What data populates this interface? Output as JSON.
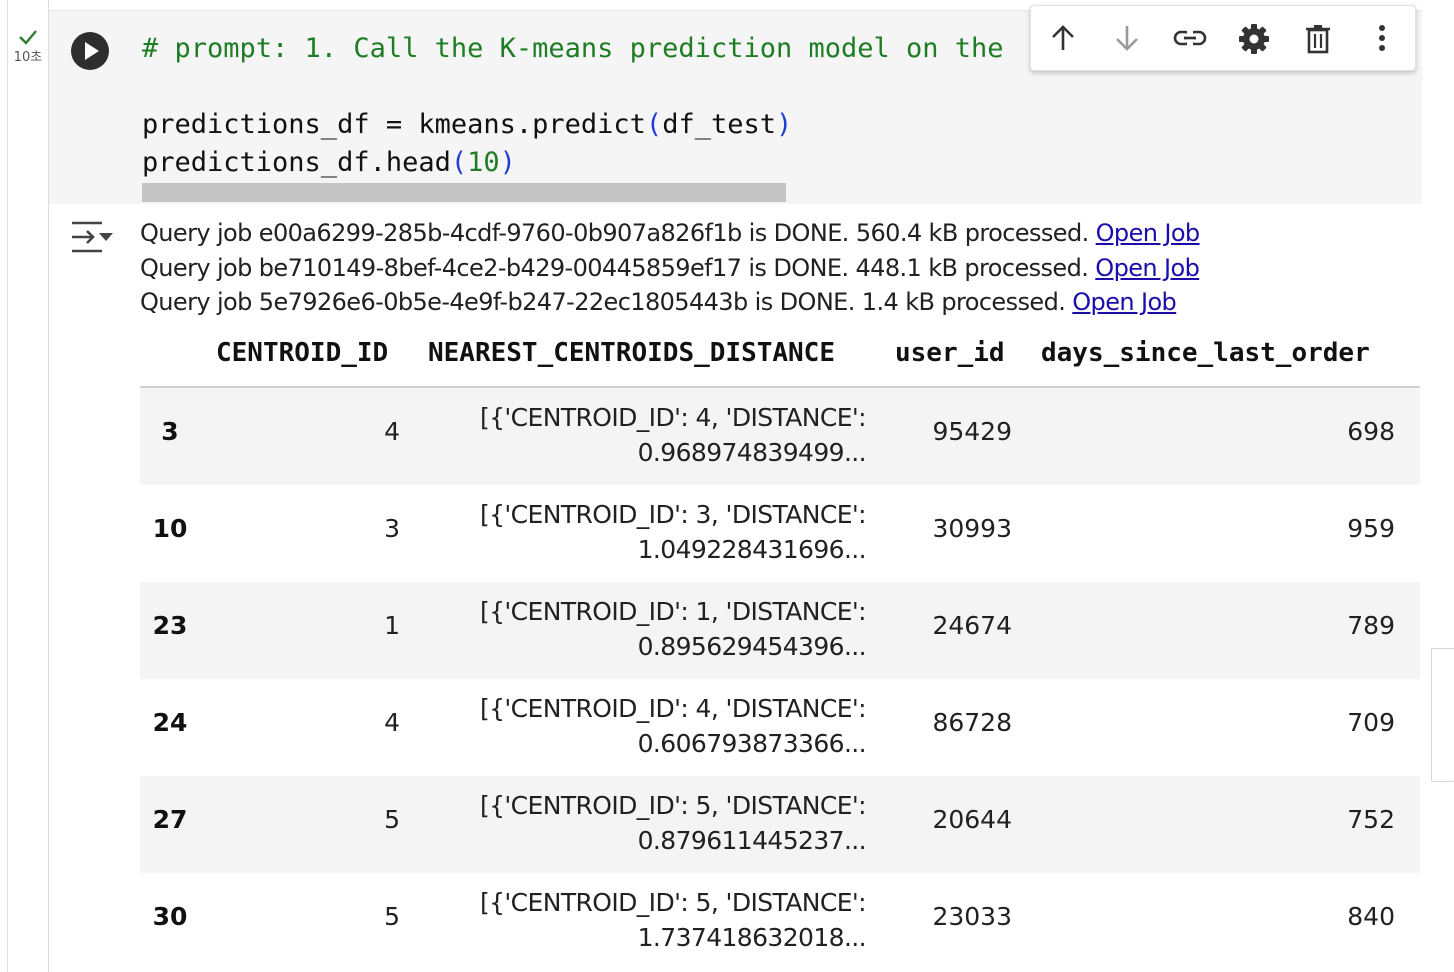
{
  "execution": {
    "time": "10초",
    "status": "success"
  },
  "code": {
    "line1": "# prompt: 1. Call the K-means prediction model on the",
    "line3_a": "predictions_df = kmeans.predict",
    "line3_paren_open": "(",
    "line3_arg": "df_test",
    "line3_paren_close": ")",
    "line4_a": "predictions_df.head",
    "line4_paren_open": "(",
    "line4_arg": "10",
    "line4_paren_close": ")"
  },
  "toolbar": {
    "move_up": "arrow-up-icon",
    "move_down": "arrow-down-icon",
    "link": "link-icon",
    "settings": "gear-icon",
    "delete": "trash-icon",
    "more": "more-vert-icon"
  },
  "output": {
    "logs": [
      {
        "text": "Query job e00a6299-285b-4cdf-9760-0b907a826f1b is DONE. 560.4 kB processed. ",
        "link": "Open Job"
      },
      {
        "text": "Query job be710149-8bef-4ce2-b429-00445859ef17 is DONE. 448.1 kB processed. ",
        "link": "Open Job"
      },
      {
        "text": "Query job 5e7926e6-0b5e-4e9f-b247-22ec1805443b is DONE. 1.4 kB processed. ",
        "link": "Open Job"
      }
    ],
    "table": {
      "columns": [
        "CENTROID_ID",
        "NEAREST_CENTROIDS_DISTANCE",
        "user_id",
        "days_since_last_order"
      ],
      "rows": [
        {
          "index": "3",
          "centroid_id": "4",
          "distance_l1": "[{'CENTROID_ID': 4, 'DISTANCE':",
          "distance_l2": "0.968974839499...",
          "user_id": "95429",
          "days": "698"
        },
        {
          "index": "10",
          "centroid_id": "3",
          "distance_l1": "[{'CENTROID_ID': 3, 'DISTANCE':",
          "distance_l2": "1.049228431696...",
          "user_id": "30993",
          "days": "959"
        },
        {
          "index": "23",
          "centroid_id": "1",
          "distance_l1": "[{'CENTROID_ID': 1, 'DISTANCE':",
          "distance_l2": "0.895629454396...",
          "user_id": "24674",
          "days": "789"
        },
        {
          "index": "24",
          "centroid_id": "4",
          "distance_l1": "[{'CENTROID_ID': 4, 'DISTANCE':",
          "distance_l2": "0.606793873366...",
          "user_id": "86728",
          "days": "709"
        },
        {
          "index": "27",
          "centroid_id": "5",
          "distance_l1": "[{'CENTROID_ID': 5, 'DISTANCE':",
          "distance_l2": "0.879611445237...",
          "user_id": "20644",
          "days": "752"
        },
        {
          "index": "30",
          "centroid_id": "5",
          "distance_l1": "[{'CENTROID_ID': 5, 'DISTANCE':",
          "distance_l2": "1.737418632018...",
          "user_id": "23033",
          "days": "840"
        }
      ]
    }
  },
  "colors": {
    "link": "#1a0dab",
    "comment": "#1e7d24",
    "paren": "#1f3dd6",
    "row_shade": "#f4f4f4"
  }
}
